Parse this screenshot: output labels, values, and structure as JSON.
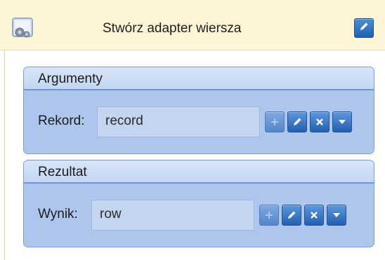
{
  "header": {
    "title": "Stwórz adapter wiersza",
    "icon": "activity-gear-icon",
    "edit_icon": "pencil-icon"
  },
  "groups": [
    {
      "title": "Argumenty",
      "field_label": "Rekord:",
      "field_value": "record",
      "buttons": [
        "add-icon",
        "pencil-icon",
        "close-icon",
        "dropdown-arrow-icon"
      ]
    },
    {
      "title": "Rezultat",
      "field_label": "Wynik:",
      "field_value": "row",
      "buttons": [
        "add-icon",
        "pencil-icon",
        "close-icon",
        "dropdown-arrow-icon"
      ]
    }
  ],
  "colors": {
    "header_bg": "#fdf5d6",
    "group_bg": "#aec6ed",
    "button_blue": "#2160b2"
  }
}
